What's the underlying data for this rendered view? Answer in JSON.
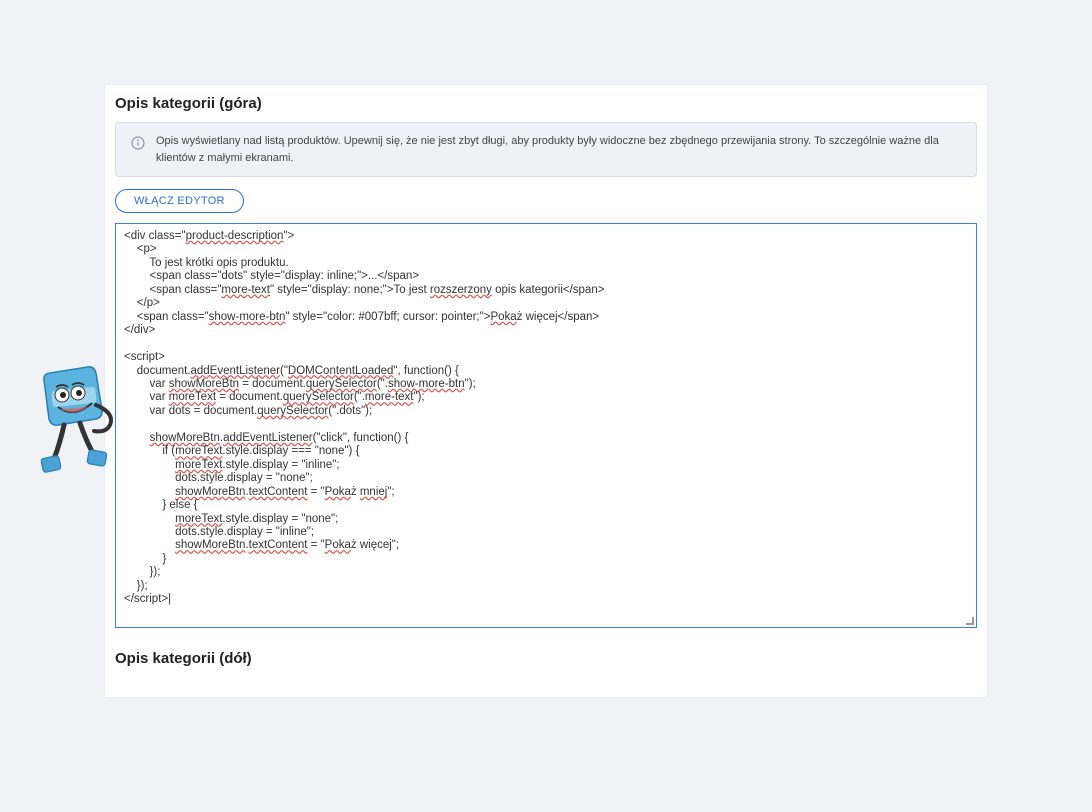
{
  "section_top": {
    "title": "Opis kategorii (góra)",
    "info_text": "Opis wyświetlany nad listą produktów. Upewnij się, że nie jest zbyt długi, aby produkty były widoczne bez zbędnego przewijania strony. To szczególnie ważne dla klientów z małymi ekranami.",
    "editor_button": "WŁĄCZ EDYTOR",
    "code_content": "<div class=\"product-description\">\n    <p>\n        To jest krótki opis produktu.\n        <span class=\"dots\" style=\"display: inline;\">...</span>\n        <span class=\"more-text\" style=\"display: none;\">To jest rozszerzony opis kategorii</span>\n    </p>\n    <span class=\"show-more-btn\" style=\"color: #007bff; cursor: pointer;\">Pokaż więcej</span>\n</div>\n\n<script>\n    document.addEventListener(\"DOMContentLoaded\", function() {\n        var showMoreBtn = document.querySelector(\".show-more-btn\");\n        var moreText = document.querySelector(\".more-text\");\n        var dots = document.querySelector(\".dots\");\n\n        showMoreBtn.addEventListener(\"click\", function() {\n            if (moreText.style.display === \"none\") {\n                moreText.style.display = \"inline\";\n                dots.style.display = \"none\";\n                showMoreBtn.textContent = \"Pokaż mniej\";\n            } else {\n                moreText.style.display = \"none\";\n                dots.style.display = \"inline\";\n                showMoreBtn.textContent = \"Pokaż więcej\";\n            }\n        });\n    });\n</script>|"
  },
  "section_bottom": {
    "title": "Opis kategorii (dół)"
  }
}
